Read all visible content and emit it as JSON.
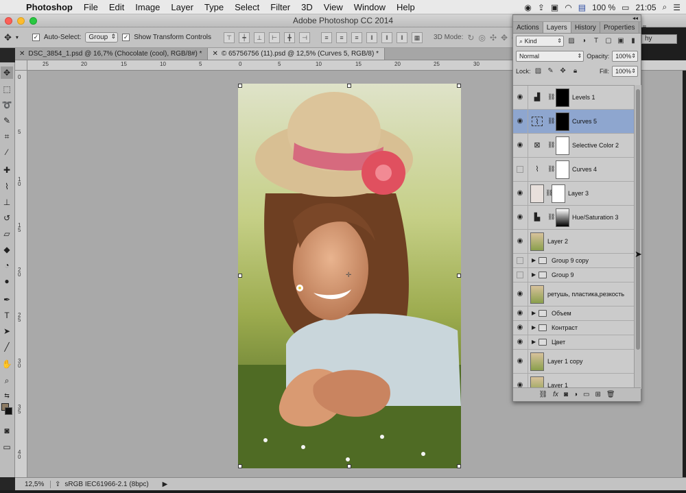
{
  "menubar": {
    "app_name": "Photoshop",
    "items": [
      "File",
      "Edit",
      "Image",
      "Layer",
      "Type",
      "Select",
      "Filter",
      "3D",
      "View",
      "Window",
      "Help"
    ],
    "battery": "100 %",
    "clock": "21:05"
  },
  "window": {
    "title": "Adobe Photoshop CC 2014"
  },
  "options_bar": {
    "auto_select_label": "Auto-Select:",
    "auto_select_value": "Group",
    "show_transform_label": "Show Transform Controls",
    "mode_3d_label": "3D Mode:",
    "right_dropdown": "hy"
  },
  "document_tabs": [
    {
      "label": "DSC_3854_1.psd @ 16,7% (Chocolate (cool), RGB/8#) *"
    },
    {
      "label": "© 65756756 (11).psd @ 12,5% (Curves 5, RGB/8) *"
    }
  ],
  "rulers": {
    "h_labels": [
      "25",
      "20",
      "15",
      "10",
      "5",
      "0",
      "5",
      "10",
      "15",
      "20",
      "25",
      "30",
      "35"
    ],
    "v_labels": [
      "0",
      "5",
      "1\n0",
      "1\n5",
      "2\n0",
      "2\n5",
      "3\n0",
      "3\n5",
      "4\n0"
    ]
  },
  "status_bar": {
    "zoom": "12,5%",
    "profile": "sRGB IEC61966-2.1 (8bpc)"
  },
  "layers_panel": {
    "tabs": [
      "Actions",
      "Layers",
      "History",
      "Properties"
    ],
    "active_tab": "Layers",
    "kind_filter": "Kind",
    "blend_mode": "Normal",
    "opacity_label": "Opacity:",
    "opacity_value": "100%",
    "lock_label": "Lock:",
    "fill_label": "Fill:",
    "fill_value": "100%",
    "layers": [
      {
        "name": "Levels 1",
        "type": "adjustment",
        "adj_icon": "levels-icon",
        "visible": true,
        "selected": false
      },
      {
        "name": "Curves 5",
        "type": "adjustment",
        "adj_icon": "curves-icon",
        "visible": true,
        "selected": true
      },
      {
        "name": "Selective Color 2",
        "type": "adjustment",
        "adj_icon": "selective-color-icon",
        "visible": true,
        "selected": false
      },
      {
        "name": "Curves 4",
        "type": "adjustment",
        "adj_icon": "curves-icon",
        "visible": false,
        "selected": false
      },
      {
        "name": "Layer 3",
        "type": "masked-pixel",
        "visible": true,
        "selected": false
      },
      {
        "name": "Hue/Saturation 3",
        "type": "adjustment",
        "adj_icon": "hue-saturation-icon",
        "visible": true,
        "selected": false
      },
      {
        "name": "Layer 2",
        "type": "pixel",
        "visible": true,
        "selected": false
      },
      {
        "name": "Group 9 copy",
        "type": "group",
        "visible": false,
        "selected": false
      },
      {
        "name": "Group 9",
        "type": "group",
        "visible": false,
        "selected": false
      },
      {
        "name": "ретушь, пластика,резкость",
        "type": "pixel",
        "visible": true,
        "selected": false
      },
      {
        "name": "Объем",
        "type": "group",
        "visible": true,
        "selected": false
      },
      {
        "name": "Контраст",
        "type": "group",
        "visible": true,
        "selected": false
      },
      {
        "name": "Цвет",
        "type": "group",
        "visible": true,
        "selected": false
      },
      {
        "name": "Layer 1 copy",
        "type": "pixel",
        "visible": true,
        "selected": false
      },
      {
        "name": "Layer 1",
        "type": "pixel",
        "visible": true,
        "selected": false
      }
    ]
  }
}
